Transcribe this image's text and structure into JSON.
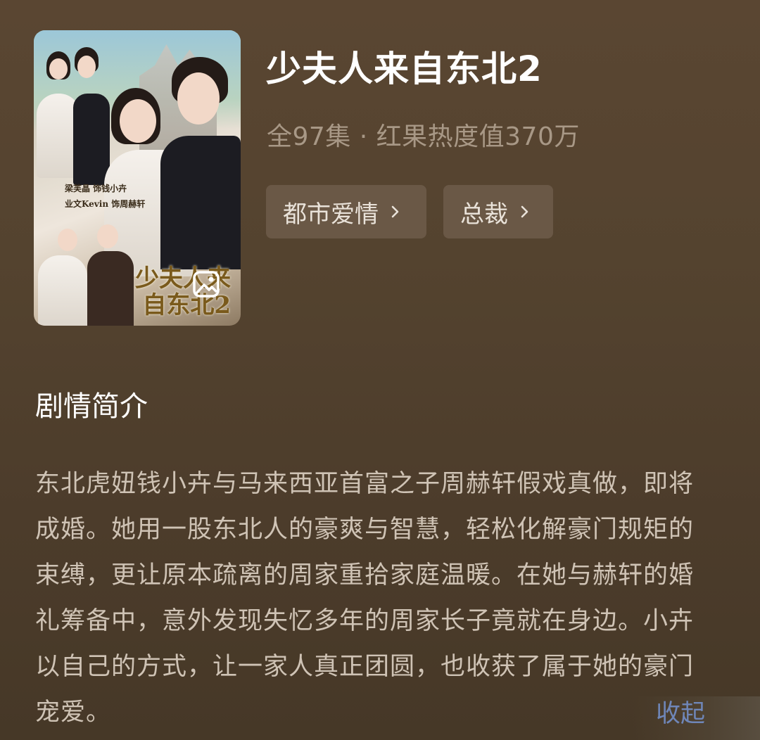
{
  "poster": {
    "title_art": "少夫人来自东北2",
    "cast_line_1": "梁芙晶 饰钱小卉",
    "cast_line_2": "业文Kevin 饰周赫轩",
    "overlay_icon": "image-icon"
  },
  "show": {
    "title": "少夫人来自东北2",
    "meta": "全97集 · 红果热度值370万"
  },
  "tags": [
    {
      "label": "都市爱情",
      "icon": "chevron-right-icon"
    },
    {
      "label": "总裁",
      "icon": "chevron-right-icon"
    }
  ],
  "synopsis": {
    "heading": "剧情简介",
    "text": "东北虎妞钱小卉与马来西亚首富之子周赫轩假戏真做，即将成婚。她用一股东北人的豪爽与智慧，轻松化解豪门规矩的束缚，更让原本疏离的周家重拾家庭温暖。在她与赫轩的婚礼筹备中，意外发现失忆多年的周家长子竟就在身边。小卉以自己的方式，让一家人真正团圆，也收获了属于她的豪门宠爱。",
    "collapse_label": "收起"
  },
  "colors": {
    "background": "#54432f",
    "tag_bg": "#6a5846",
    "meta_text": "#a89886",
    "body_text": "#cfc3b5",
    "link": "#6f86b8"
  }
}
